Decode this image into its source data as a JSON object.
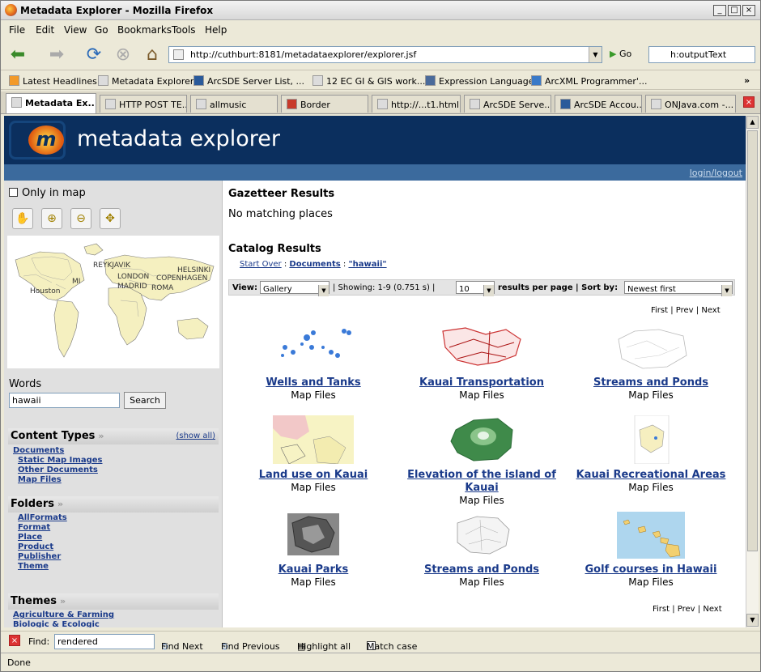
{
  "window": {
    "title": "Metadata Explorer - Mozilla Firefox"
  },
  "menu": [
    "File",
    "Edit",
    "View",
    "Go",
    "Bookmarks",
    "Tools",
    "Help"
  ],
  "address": {
    "url": "http://cuthburt:8181/metadataexplorer/explorer.jsf",
    "go_label": "Go",
    "search_value": "h:outputText"
  },
  "bookmarks": [
    "Latest Headlines",
    "Metadata Explorer",
    "ArcSDE Server List, ...",
    "12 EC GI & GIS work...",
    "Expression Language",
    "ArcXML Programmer'..."
  ],
  "tabs": [
    "Metadata Ex...",
    "HTTP POST TE...",
    "allmusic",
    "Border",
    "http://...t1.html",
    "ArcSDE Serve...",
    "ArcSDE Accou...",
    "ONJava.com -..."
  ],
  "banner": {
    "logo_letter": "m",
    "title": "metadata explorer",
    "login_link": "login/logout"
  },
  "left": {
    "only_in_map": "Only in map",
    "map_labels": [
      "REYKJAVIK",
      "LONDON",
      "MADRID",
      "HELSINKI",
      "COPENHAGEN",
      "ROMA",
      "Houston",
      "MI"
    ],
    "words_label": "Words",
    "words_value": "hawaii",
    "search_button": "Search",
    "content_types": {
      "title": "Content Types",
      "show_all": "(show all)",
      "items": [
        "Documents",
        "Static Map Images",
        "Other Documents",
        "Map Files"
      ]
    },
    "folders": {
      "title": "Folders",
      "items": [
        "AllFormats",
        "Format",
        "Place",
        "Product",
        "Publisher",
        "Theme"
      ]
    },
    "themes": {
      "title": "Themes",
      "items": [
        "Agriculture & Farming",
        "Biologic & Ecologic"
      ]
    }
  },
  "main": {
    "gazetteer_title": "Gazetteer Results",
    "gazetteer_none": "No matching places",
    "catalog_title": "Catalog Results",
    "breadcrumb": {
      "start_over": "Start Over",
      "sep": ":",
      "documents": "Documents",
      "query": "\"hawaii\""
    },
    "toolbar": {
      "view_label": "View:",
      "view_value": "Gallery",
      "showing": "| Showing: 1-9 (0.751 s) |",
      "per_page_value": "10",
      "per_page_label": "results per page",
      "sort_label": "| Sort by:",
      "sort_value": "Newest first"
    },
    "pager": {
      "first": "First",
      "prev": "Prev",
      "next": "Next"
    },
    "results": [
      {
        "title": "Wells and Tanks",
        "type": "Map Files"
      },
      {
        "title": "Kauai Transportation",
        "type": "Map Files"
      },
      {
        "title": "Streams and Ponds",
        "type": "Map Files"
      },
      {
        "title": "Land use on Kauai",
        "type": "Map Files"
      },
      {
        "title": "Elevation of the island of Kauai",
        "type": "Map Files"
      },
      {
        "title": "Kauai Recreational Areas",
        "type": "Map Files"
      },
      {
        "title": "Kauai Parks",
        "type": "Map Files"
      },
      {
        "title": "Streams and Ponds",
        "type": "Map Files"
      },
      {
        "title": "Golf courses in Hawaii",
        "type": "Map Files"
      }
    ]
  },
  "findbar": {
    "label": "Find:",
    "value": "rendered",
    "next": "Find Next",
    "previous": "Find Previous",
    "highlight": "Highlight all",
    "match_case": "Match case"
  },
  "status": {
    "text": "Done"
  }
}
